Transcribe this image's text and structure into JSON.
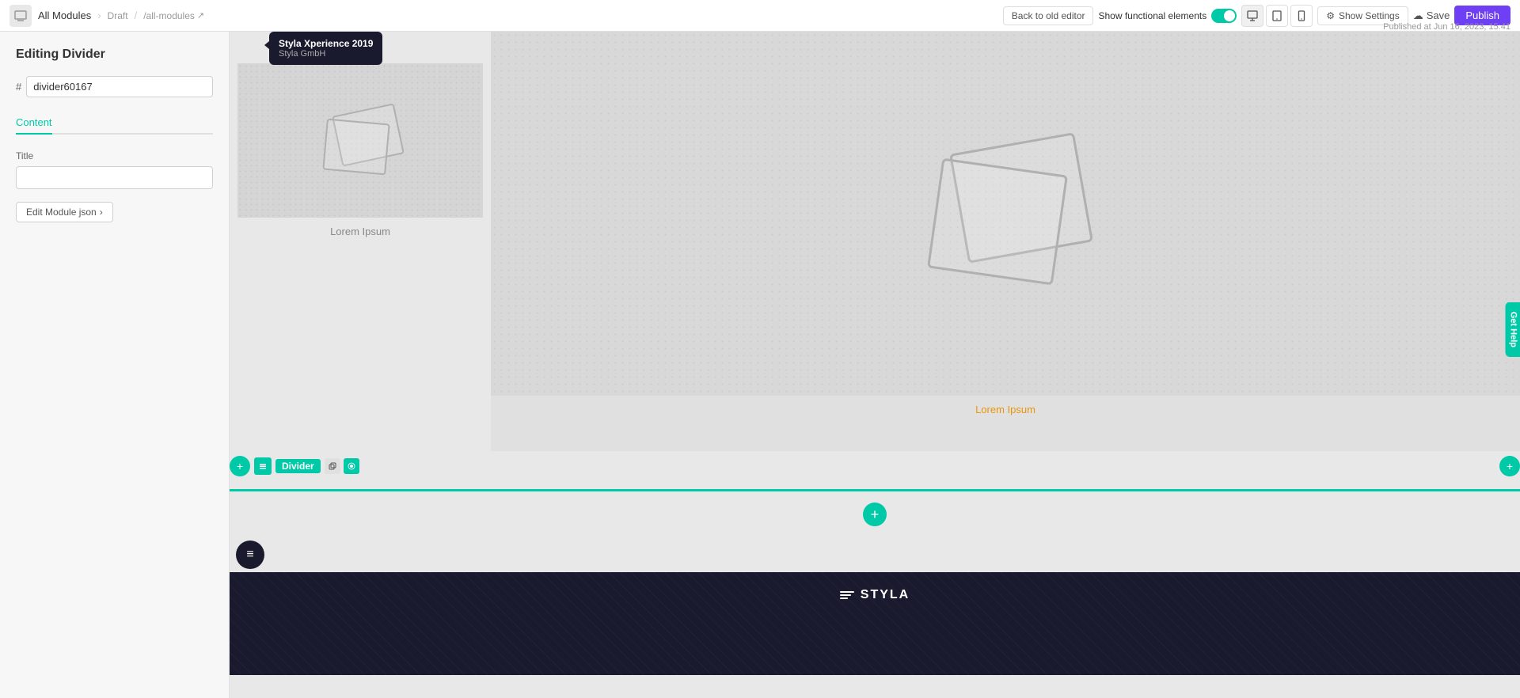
{
  "topbar": {
    "modules_label": "All Modules",
    "status_label": "Draft",
    "breadcrumb_path": "/all-modules",
    "back_to_old_editor_label": "Back to old editor",
    "show_functional_elements_label": "Show functional elements",
    "show_settings_label": "Show Settings",
    "save_label": "Save",
    "publish_label": "Publish",
    "published_date": "Published at Jun 16, 2023, 15:41"
  },
  "sidebar": {
    "title": "Editing Divider",
    "id_hash": "#",
    "id_value": "divider60167",
    "tab_content_label": "Content",
    "field_title_label": "Title",
    "field_title_placeholder": "",
    "btn_edit_json_label": "Edit Module json",
    "btn_edit_json_arrow": "›"
  },
  "canvas": {
    "caption_left": "Lorem Ipsum",
    "caption_right": "Lorem Ipsum",
    "divider_label": "Divider"
  },
  "badge": {
    "company": "Styla Xperience 2019",
    "sub": "Styla GmbH"
  },
  "footer": {
    "logo_text": "STYLA"
  },
  "help_tab": "Get Help",
  "icons": {
    "desktop": "🖥",
    "tablet": "⬜",
    "mobile": "📱",
    "settings_gear": "⚙",
    "save_cloud": "💾",
    "plus": "+",
    "external_link": "↗"
  }
}
